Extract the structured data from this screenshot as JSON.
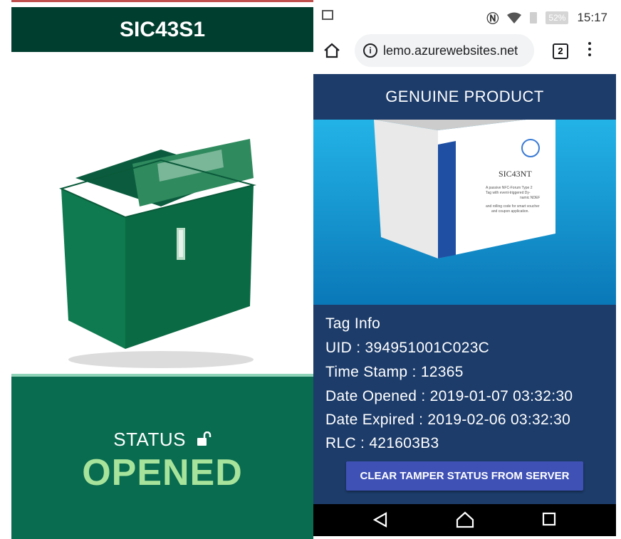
{
  "left": {
    "title": "SIC43S1",
    "status_label": "STATUS",
    "status_value": "OPENED"
  },
  "phone": {
    "time": "15:17",
    "battery": "52%",
    "url": "lemo.azurewebsites.net",
    "tab_count": "2"
  },
  "page": {
    "header": "GENUINE PRODUCT",
    "product_box_label": "SIC43NT",
    "product_box_text_1": "A passive NFC-Forum Type 2",
    "product_box_text_2": "Tag with event-triggered Dy-",
    "product_box_text_3": "namic NDEF",
    "product_box_text_4": "and rolling code for smart voucher",
    "product_box_text_5": "and coupon application.",
    "tag_info": {
      "heading": "Tag Info",
      "uid": "UID : 394951001C023C",
      "timestamp": "Time Stamp : 12365",
      "date_opened": "Date Opened : 2019-01-07 03:32:30",
      "date_expired": "Date Expired : 2019-02-06 03:32:30",
      "rlc": "RLC : 421603B3"
    },
    "clear_button": "CLEAR TAMPER STATUS FROM SERVER"
  },
  "colors": {
    "left_header": "#003e2f",
    "status_bg": "#096b4f",
    "status_value": "#a7e39b",
    "web_header": "#1d3c6a",
    "button": "#3f51b5"
  },
  "icons": [
    "image-icon",
    "nfc-icon",
    "wifi-icon",
    "battery-alert-icon",
    "battery-icon",
    "home-icon",
    "info-icon",
    "tabs-icon",
    "menu-icon",
    "unlock-icon",
    "back-icon",
    "nav-home-icon",
    "recents-icon"
  ]
}
